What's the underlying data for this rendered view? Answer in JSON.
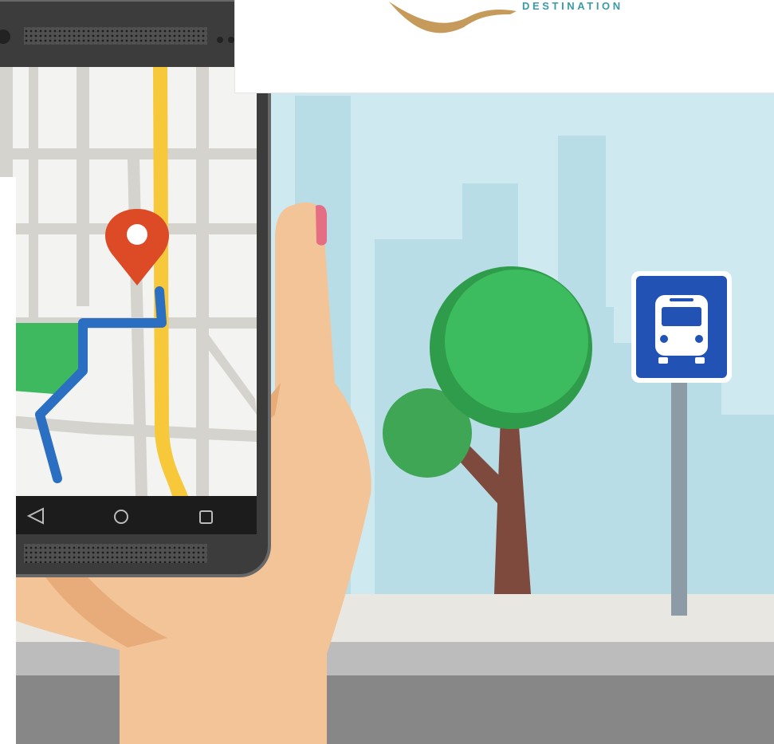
{
  "brand": {
    "logo_subtitle": "DESTINATION",
    "accent_color": "#3a9aa6",
    "swoosh_color": "#c69a5b"
  },
  "phone": {
    "navigation_buttons": [
      "back-icon",
      "home-icon",
      "recent-apps-icon"
    ]
  },
  "map": {
    "marker_icon": "location-pin-icon",
    "marker_color": "#dc4a26",
    "route_color": "#2a6fc2",
    "highway_color": "#f7c83a",
    "park_color": "#3fb95f"
  },
  "sign": {
    "icon": "bus-icon",
    "color": "#2352b5"
  },
  "scene_colors": {
    "sky": "#cfe9f0",
    "buildings": "#b6dde6",
    "tree_canopy": "#3cb35b",
    "tree_trunk": "#7e4a3d",
    "skin": "#f3c498",
    "road": "#888888",
    "sidewalk": "#e8e7e2"
  }
}
